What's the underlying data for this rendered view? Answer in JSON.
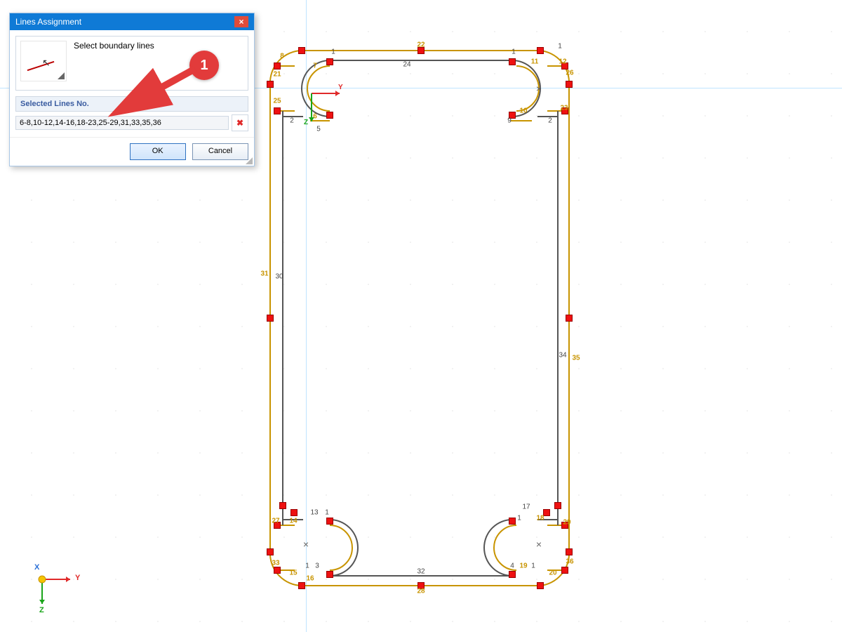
{
  "dialog": {
    "title": "Lines Assignment",
    "instruction": "Select boundary lines",
    "selected_header": "Selected Lines No.",
    "selected_value": "6-8,10-12,14-16,18-23,25-29,31,33,35,36",
    "ok": "OK",
    "cancel": "Cancel",
    "close_glyph": "×",
    "clear_glyph": "✖"
  },
  "annotation": {
    "badge": "1"
  },
  "axes": {
    "x": "X",
    "y": "Y",
    "z": "Z"
  },
  "model": {
    "black_labels": [
      "1",
      "2",
      "3",
      "4",
      "5",
      "9",
      "13",
      "17",
      "24",
      "30",
      "32",
      "34"
    ],
    "gold_labels": [
      "6",
      "7",
      "8",
      "10",
      "11",
      "12",
      "14",
      "15",
      "16",
      "18",
      "19",
      "20",
      "21",
      "22",
      "23",
      "25",
      "26",
      "27",
      "28",
      "29",
      "31",
      "33",
      "35",
      "36"
    ]
  },
  "colors": {
    "sel": "#c89400",
    "line": "#555",
    "selline": "#c89400",
    "red": "#e11"
  }
}
